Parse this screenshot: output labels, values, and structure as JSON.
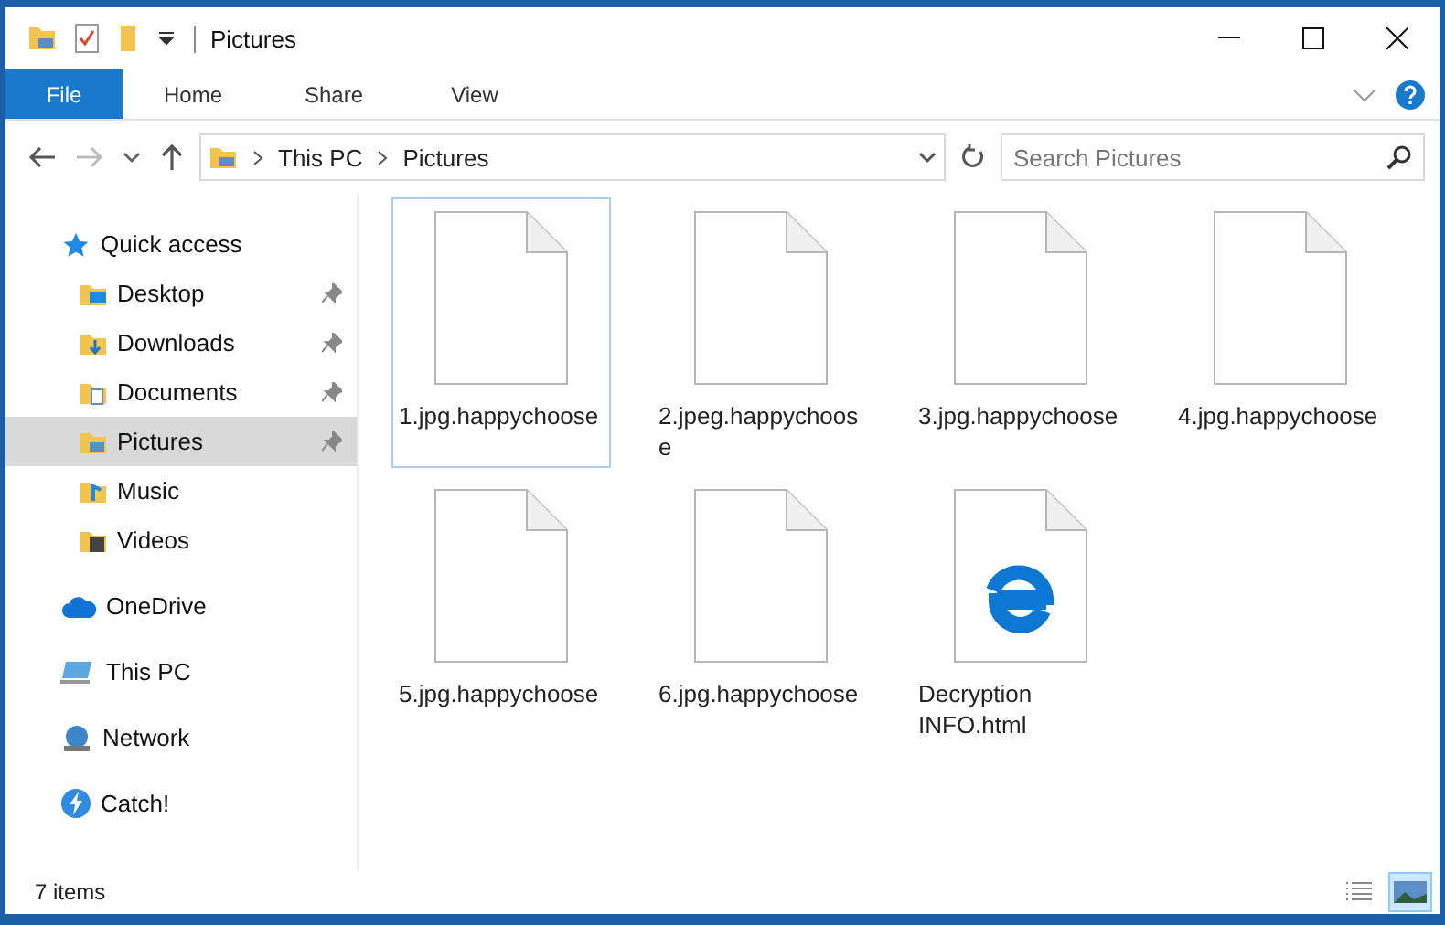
{
  "window": {
    "title": "Pictures"
  },
  "ribbon_tabs": [
    {
      "label": "File",
      "selected": true
    },
    {
      "label": "Home",
      "selected": false
    },
    {
      "label": "Share",
      "selected": false
    },
    {
      "label": "View",
      "selected": false
    }
  ],
  "address": {
    "path": [
      "This PC",
      "Pictures"
    ]
  },
  "search": {
    "placeholder": "Search Pictures"
  },
  "sidebar": {
    "items": [
      {
        "label": "Quick access",
        "kind": "star",
        "selected": false,
        "children": [
          {
            "label": "Desktop",
            "kind": "desktop",
            "selected": false,
            "pinned": true
          },
          {
            "label": "Downloads",
            "kind": "downloads",
            "selected": false,
            "pinned": true
          },
          {
            "label": "Documents",
            "kind": "documents",
            "selected": false,
            "pinned": true
          },
          {
            "label": "Pictures",
            "kind": "pictures",
            "selected": true,
            "pinned": true
          },
          {
            "label": "Music",
            "kind": "music",
            "selected": false,
            "pinned": false
          },
          {
            "label": "Videos",
            "kind": "videos",
            "selected": false,
            "pinned": false
          }
        ]
      },
      {
        "label": "OneDrive",
        "kind": "cloud",
        "selected": false
      },
      {
        "label": "This PC",
        "kind": "pc",
        "selected": false
      },
      {
        "label": "Network",
        "kind": "network",
        "selected": false
      },
      {
        "label": "Catch!",
        "kind": "catch",
        "selected": false
      }
    ]
  },
  "files": [
    {
      "name": "1.jpg.happychoose",
      "kind": "blank",
      "selected": true
    },
    {
      "name": "2.jpeg.happychoose",
      "kind": "blank",
      "selected": false
    },
    {
      "name": "3.jpg.happychoose",
      "kind": "blank",
      "selected": false
    },
    {
      "name": "4.jpg.happychoose",
      "kind": "blank",
      "selected": false
    },
    {
      "name": "5.jpg.happychoose",
      "kind": "blank",
      "selected": false
    },
    {
      "name": "6.jpg.happychoose",
      "kind": "blank",
      "selected": false
    },
    {
      "name": "Decryption INFO.html",
      "kind": "html",
      "selected": false
    }
  ],
  "status_bar": {
    "count": "7 items"
  },
  "view_buttons": [
    {
      "kind": "details",
      "selected": false
    },
    {
      "kind": "large_icons",
      "selected": true
    }
  ]
}
